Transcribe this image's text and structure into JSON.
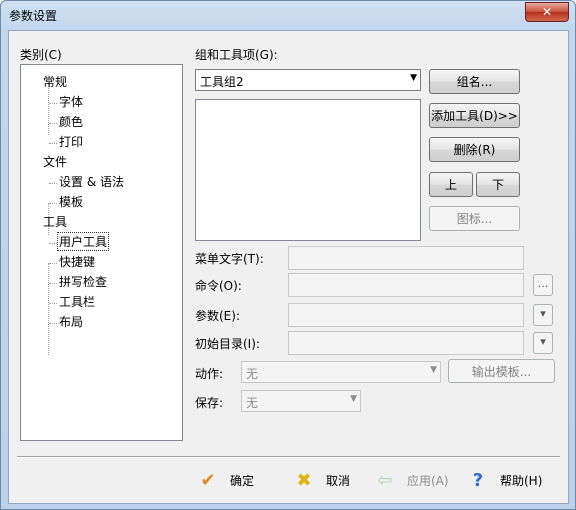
{
  "window": {
    "title": "参数设置",
    "close_label": "✕"
  },
  "category": {
    "label": "类别(C)",
    "items": [
      {
        "label": "常规",
        "level": 0
      },
      {
        "label": "字体",
        "level": 1
      },
      {
        "label": "颜色",
        "level": 1
      },
      {
        "label": "打印",
        "level": 1
      },
      {
        "label": "文件",
        "level": 0
      },
      {
        "label": "设置 & 语法",
        "level": 1
      },
      {
        "label": "模板",
        "level": 1
      },
      {
        "label": "工具",
        "level": 0
      },
      {
        "label": "用户工具",
        "level": 1,
        "selected": true
      },
      {
        "label": "快捷键",
        "level": 1
      },
      {
        "label": "拼写检查",
        "level": 1
      },
      {
        "label": "工具栏",
        "level": 1
      },
      {
        "label": "布局",
        "level": 1
      }
    ]
  },
  "group": {
    "label": "组和工具项(G):",
    "selected": "工具组2",
    "name_button": "组名...",
    "add_tool_button": "添加工具(D)>>",
    "delete_button": "删除(R)",
    "up_button": "上",
    "down_button": "下",
    "icon_button": "图标..."
  },
  "fields": {
    "menu_text_label": "菜单文字(T):",
    "command_label": "命令(O):",
    "command_browse": "...",
    "params_label": "参数(E):",
    "init_dir_label": "初始目录(I):",
    "action_label": "动作:",
    "action_value": "无",
    "output_template_button": "输出模板...",
    "save_label": "保存:",
    "save_value": "无"
  },
  "footer": {
    "ok": "确定",
    "cancel": "取消",
    "apply": "应用(A)",
    "help": "帮助(H)"
  }
}
